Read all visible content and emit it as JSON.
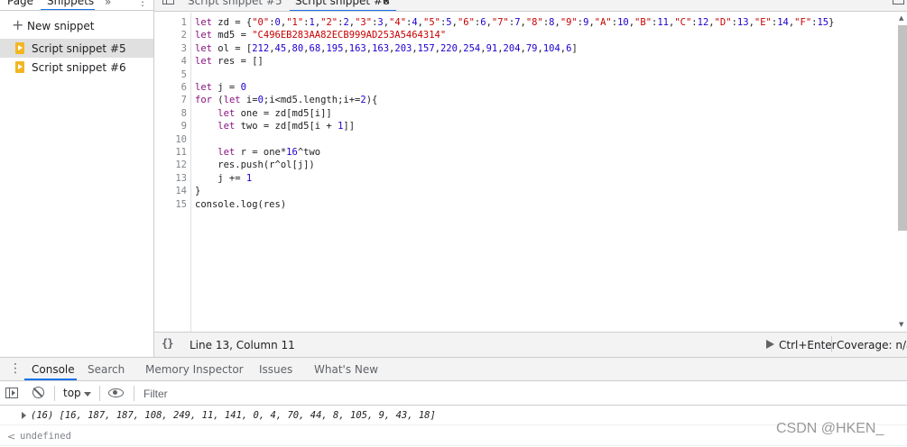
{
  "navigator": {
    "tabs": {
      "page": "Page",
      "snippets": "Snippets",
      "more": "»",
      "menu": "⋮"
    },
    "new_snippet": {
      "icon": "plus-icon",
      "label": "New snippet"
    },
    "snippets": [
      {
        "label": "Script snippet #5",
        "selected": true
      },
      {
        "label": "Script snippet #6",
        "selected": false
      }
    ]
  },
  "editor": {
    "tabs": [
      {
        "label": "Script snippet #5",
        "active": false
      },
      {
        "label": "Script snippet #6",
        "active": true,
        "close": "×"
      }
    ],
    "code_lines": [
      "let zd = {\"0\":0,\"1\":1,\"2\":2,\"3\":3,\"4\":4,\"5\":5,\"6\":6,\"7\":7,\"8\":8,\"9\":9,\"A\":10,\"B\":11,\"C\":12,\"D\":13,\"E\":14,\"F\":15}",
      "let md5 = \"C496EB283AA82ECB999AD253A5464314\"",
      "let ol = [212,45,80,68,195,163,163,203,157,220,254,91,204,79,104,6]",
      "let res = []",
      "",
      "let j = 0",
      "for (let i=0;i<md5.length;i+=2){",
      "    let one = zd[md5[i]]",
      "    let two = zd[md5[i + 1]]",
      "",
      "    let r = one*16^two",
      "    res.push(r^ol[j])",
      "    j += 1",
      "}",
      "console.log(res)"
    ],
    "line_numbers": [
      "1",
      "2",
      "3",
      "4",
      "5",
      "6",
      "7",
      "8",
      "9",
      "10",
      "11",
      "12",
      "13",
      "14",
      "15"
    ]
  },
  "statusbar": {
    "format_icon": "{}",
    "cursor_position": "Line 13, Column 11",
    "run_label": "Ctrl+Enter",
    "coverage": "Coverage: n/a"
  },
  "drawer": {
    "menu": "⋮",
    "tabs": {
      "console": "Console",
      "search": "Search",
      "memory": "Memory Inspector",
      "issues": "Issues",
      "whatsnew": "What's New"
    },
    "active_tab": "Console"
  },
  "console_toolbar": {
    "context": "top",
    "filter_placeholder": "Filter"
  },
  "console_output": {
    "array_log": "(16) [16, 187, 187, 108, 249, 11, 141, 0, 4, 70, 44, 8, 105, 9, 43, 18]",
    "return_icon": "<",
    "return_value": "undefined"
  },
  "watermark": "CSDN @HKEN_",
  "colors": {
    "accent": "#1a73e8",
    "keyword": "#881280",
    "string": "#c80000",
    "number": "#1c00cf",
    "snippet_icon": "#f2b624"
  }
}
